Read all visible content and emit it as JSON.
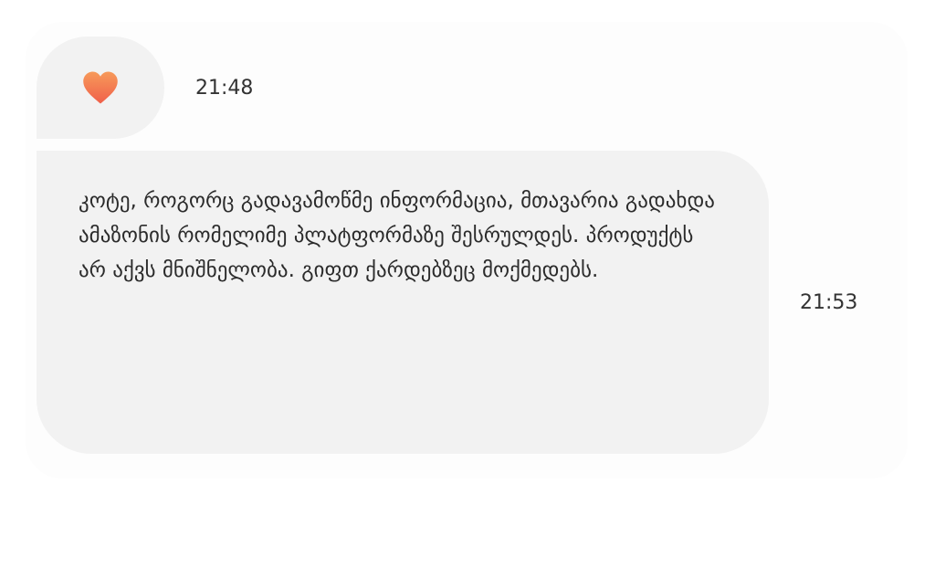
{
  "messages": [
    {
      "type": "reaction",
      "icon": "heart-icon",
      "time": "21:48",
      "colors": {
        "heart_top": "#f79a5a",
        "heart_bottom": "#f0604a"
      }
    },
    {
      "type": "text",
      "text": "კოტე, როგორც გადავამოწმე ინფორმაცია, მთავარია გადახდა ამაზონის რომელიმე პლატფორმაზე შესრულდეს. პროდუქტს არ აქვს მნიშნელობა. გიფთ ქარდებზეც მოქმედებს.",
      "time": "21:53"
    }
  ]
}
